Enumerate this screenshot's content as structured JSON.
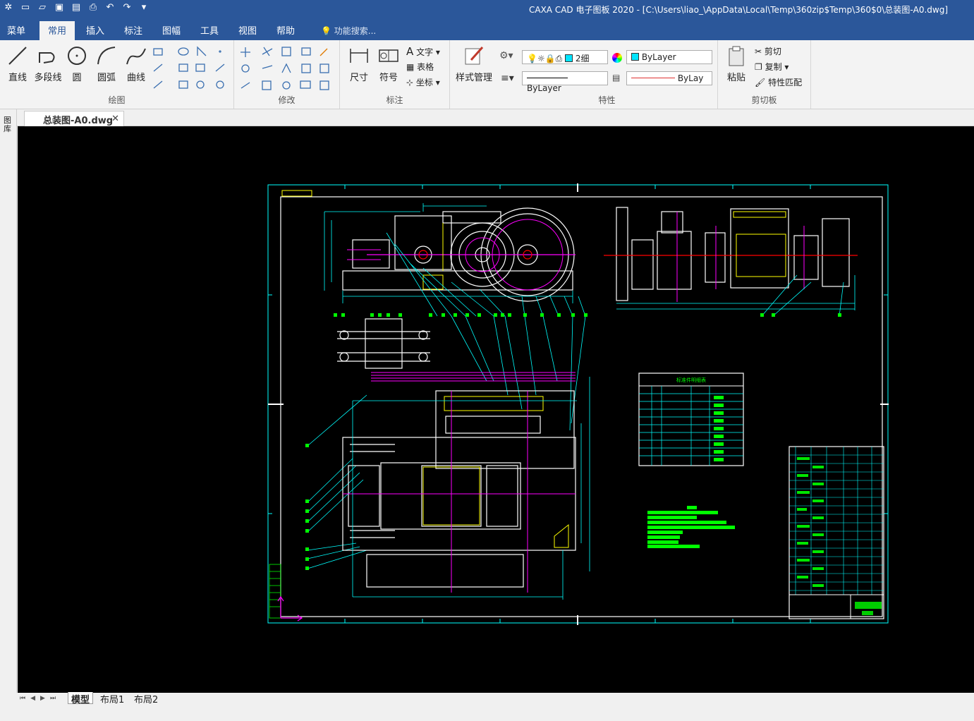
{
  "window": {
    "title": "CAXA CAD 电子图板 2020 - [C:\\Users\\liao_\\AppData\\Local\\Temp\\360zip$Temp\\360$0\\总装图-A0.dwg]"
  },
  "quick_access": [
    "app-logo-icon",
    "new-file-icon",
    "open-folder-icon",
    "save-icon",
    "save-as-icon",
    "print-icon",
    "undo-icon",
    "redo-icon",
    "customize-icon"
  ],
  "menu": {
    "items": [
      "菜单",
      "常用",
      "插入",
      "标注",
      "图幅",
      "工具",
      "视图",
      "帮助"
    ],
    "active": "常用",
    "search_placeholder": "功能搜索..."
  },
  "ribbon": {
    "draw": {
      "label": "绘图",
      "line": "直线",
      "polyline": "多段线",
      "circle": "圆",
      "arc": "圆弧",
      "curve": "曲线"
    },
    "modify": {
      "label": "修改"
    },
    "annotate": {
      "label": "标注",
      "dimension": "尺寸",
      "symbol": "符号",
      "text": "文字",
      "table": "表格",
      "coordinate": "坐标"
    },
    "style": {
      "label": "样式管理"
    },
    "properties": {
      "label": "特性",
      "line_width": "2细",
      "color_value": "ByLayer",
      "linetype_value": "ByLayer",
      "lineweight_value": "ByLay"
    },
    "clipboard": {
      "label": "剪切板",
      "paste": "粘贴",
      "cut": "剪切",
      "copy": "复制",
      "match": "特性匹配"
    }
  },
  "document_tab": {
    "name": "总装图-A0.dwg"
  },
  "left_panel": {
    "label": "图库"
  },
  "layout_tabs": [
    "模型",
    "布局1",
    "布局2"
  ],
  "active_layout": "模型",
  "drawing_title_block": {
    "parts_table_title": "标准件明细表"
  },
  "colors": {
    "title_bar": "#2b579a",
    "ribbon_bg": "#f3f3f3",
    "canvas_bg": "#000000",
    "drawing_white": "#ffffff",
    "drawing_cyan": "#00ffff",
    "drawing_magenta": "#ff00ff",
    "drawing_green": "#00ff00",
    "drawing_yellow": "#ffff00",
    "drawing_red": "#ff0000",
    "color_swatch": "#00e5ff"
  }
}
